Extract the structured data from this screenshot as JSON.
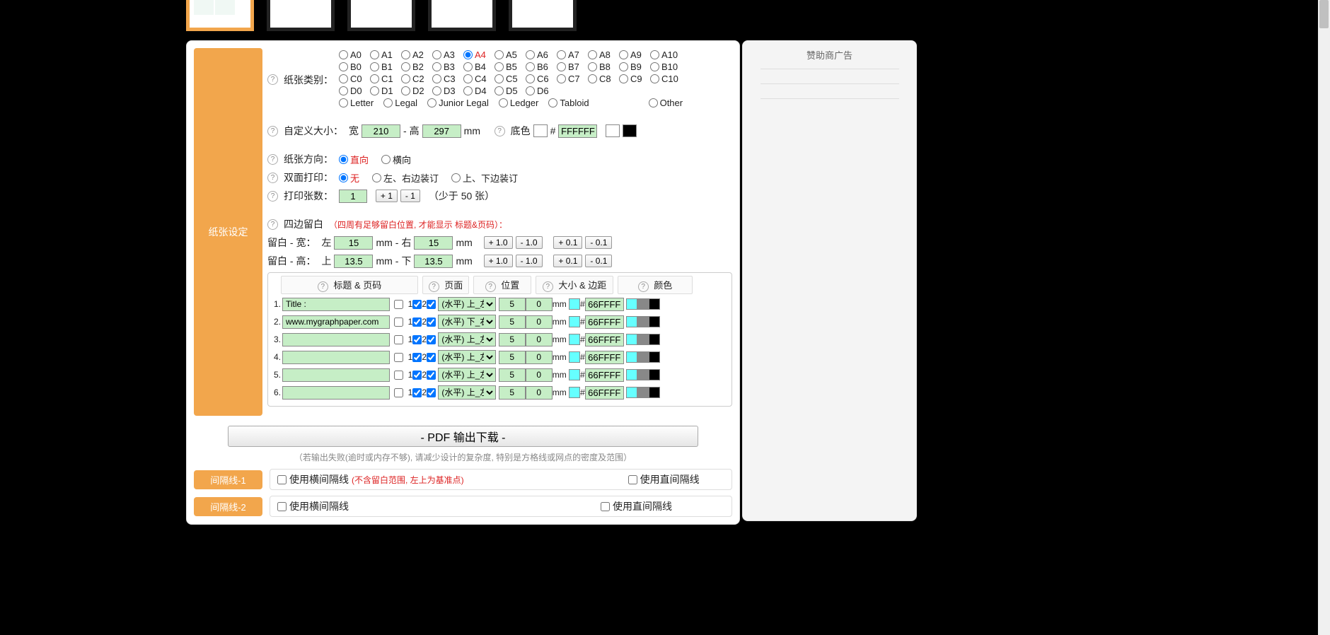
{
  "thumbs_count": 5,
  "ad": {
    "title": "赞助商广告"
  },
  "paper": {
    "section_label": "纸张设定",
    "type_label": "纸张类别：",
    "types_a": [
      "A0",
      "A1",
      "A2",
      "A3",
      "A4",
      "A5",
      "A6",
      "A7",
      "A8",
      "A9",
      "A10"
    ],
    "types_b": [
      "B0",
      "B1",
      "B2",
      "B3",
      "B4",
      "B5",
      "B6",
      "B7",
      "B8",
      "B9",
      "B10"
    ],
    "types_c": [
      "C0",
      "C1",
      "C2",
      "C3",
      "C4",
      "C5",
      "C6",
      "C7",
      "C8",
      "C9",
      "C10"
    ],
    "types_d": [
      "D0",
      "D1",
      "D2",
      "D3",
      "D4",
      "D5",
      "D6"
    ],
    "types_us": [
      "Letter",
      "Legal",
      "Junior Legal",
      "Ledger",
      "Tabloid"
    ],
    "types_other": "Other",
    "selected": "A4",
    "custom_label": "自定义大小：",
    "width_label": "宽",
    "height_label": "高",
    "unit": "mm",
    "width": "210",
    "height": "297",
    "bgcolor_label": "底色",
    "hash": "#",
    "bgcolor": "FFFFFF",
    "swatch_white": "#FFFFFF",
    "swatch_black": "#000000",
    "orient_label": "纸张方向：",
    "orient_portrait": "直向",
    "orient_landscape": "横向",
    "duplex_label": "双面打印：",
    "duplex_none": "无",
    "duplex_lr": "左、右边装订",
    "duplex_tb": "上、下边装订",
    "copies_label": "打印张数：",
    "copies": "1",
    "copies_inc": " + 1 ",
    "copies_dec": " - 1 ",
    "copies_note": "（少于 50 张）",
    "margin_label": "四边留白",
    "margin_note": "（四周有足够留白位置, 才能显示 标题&页码）：",
    "margin_w_label": "留白 - 宽：",
    "left": "左",
    "right": "右",
    "margin_h_label": "留白 - 高：",
    "top": "上",
    "bottom": "下",
    "margin_left": "15",
    "margin_right": "15",
    "margin_top": "13.5",
    "margin_bottom": "13.5",
    "inc1": " + 1.0 ",
    "dec1": " - 1.0 ",
    "inc01": " + 0.1 ",
    "dec01": " - 0.1 "
  },
  "titles": {
    "head_title": "标题 & 页码",
    "head_page": "页面",
    "head_pos": "位置",
    "head_size": "大小 & 边距",
    "head_color": "颜色",
    "unit": "mm",
    "hash": "#",
    "pos_opt1": "(水平) 上_左",
    "pos_opt2": "(水平) 下_右",
    "rows": [
      {
        "n": "1.",
        "text": "Title :",
        "p1": true,
        "p2": true,
        "pos": "(水平) 上_左",
        "s": "5",
        "m": "0",
        "hex": "66FFFF",
        "c1": "#66FFFF",
        "c2": "#888888",
        "c3": "#000000"
      },
      {
        "n": "2.",
        "text": "www.mygraphpaper.com",
        "p1": true,
        "p2": true,
        "pos": "(水平) 下_右",
        "s": "5",
        "m": "0",
        "hex": "66FFFF",
        "c1": "#66FFFF",
        "c2": "#888888",
        "c3": "#000000"
      },
      {
        "n": "3.",
        "text": "",
        "p1": true,
        "p2": true,
        "pos": "(水平) 上_左",
        "s": "5",
        "m": "0",
        "hex": "66FFFF",
        "c1": "#66FFFF",
        "c2": "#888888",
        "c3": "#000000"
      },
      {
        "n": "4.",
        "text": "",
        "p1": true,
        "p2": true,
        "pos": "(水平) 上_左",
        "s": "5",
        "m": "0",
        "hex": "66FFFF",
        "c1": "#66FFFF",
        "c2": "#888888",
        "c3": "#000000"
      },
      {
        "n": "5.",
        "text": "",
        "p1": true,
        "p2": true,
        "pos": "(水平) 上_左",
        "s": "5",
        "m": "0",
        "hex": "66FFFF",
        "c1": "#66FFFF",
        "c2": "#888888",
        "c3": "#000000"
      },
      {
        "n": "6.",
        "text": "",
        "p1": true,
        "p2": true,
        "pos": "(水平) 上_左",
        "s": "5",
        "m": "0",
        "hex": "66FFFF",
        "c1": "#66FFFF",
        "c2": "#888888",
        "c3": "#000000"
      }
    ]
  },
  "download": {
    "btn": "- PDF 输出下载 -",
    "note": "（若输出失败(逾时或内存不够), 请减少设计的复杂度, 特别是方格线或网点的密度及范围）"
  },
  "sep1": {
    "label": "间隔线-1",
    "h": "使用横间隔线",
    "hnote": "(不含留白范围, 左上为基准点)",
    "v": "使用直间隔线"
  },
  "sep2": {
    "label": "间隔线-2",
    "h": "使用横间隔线",
    "v": "使用直间隔线"
  }
}
